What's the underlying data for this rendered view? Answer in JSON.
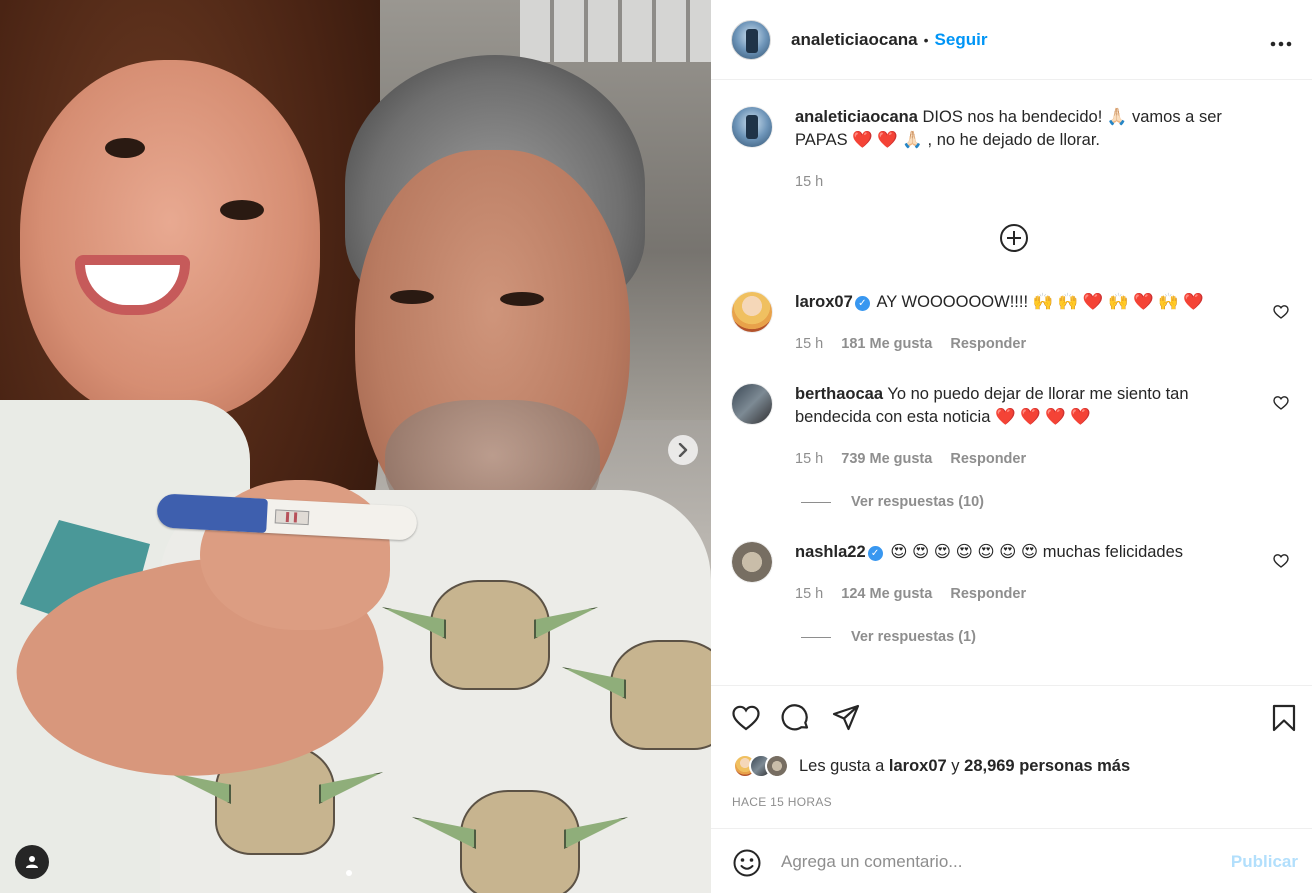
{
  "header": {
    "username": "analeticiaocana",
    "separator": "•",
    "follow_label": "Seguir",
    "more_label": "•••"
  },
  "post": {
    "caption_user": "analeticiaocana",
    "caption_text": "DIOS nos ha bendecido! 🙏🏻 vamos a ser PAPAS ❤️ ❤️ 🙏🏻 , no he dejado de llorar.",
    "time": "15 h"
  },
  "comments": [
    {
      "user": "larox07",
      "verified": true,
      "text": "AY WOOOOOOW!!!! 🙌 🙌 ❤️ 🙌 ❤️ 🙌 ❤️",
      "time": "15 h",
      "likes": "181 Me gusta",
      "reply": "Responder"
    },
    {
      "user": "berthaocaa",
      "verified": false,
      "text": "Yo no puedo dejar de llorar me siento tan bendecida con esta noticia ❤️ ❤️ ❤️ ❤️",
      "time": "15 h",
      "likes": "739 Me gusta",
      "reply": "Responder",
      "view_replies": "Ver respuestas (10)"
    },
    {
      "user": "nashla22",
      "verified": true,
      "text": "😍 😍 😍 😍 😍 😍 😍 muchas felicidades",
      "time": "15 h",
      "likes": "124 Me gusta",
      "reply": "Responder",
      "view_replies": "Ver respuestas (1)"
    }
  ],
  "likes": {
    "prefix": "Les gusta a",
    "user": "larox07",
    "connector": "y",
    "count": "28,969 personas más"
  },
  "timeago": "HACE 15 HORAS",
  "composer": {
    "placeholder": "Agrega un comentario...",
    "publish_label": "Publicar"
  },
  "colors": {
    "link_blue": "#0095f6",
    "publish_disabled": "#b2dffc",
    "secondary_text": "#8e8e8e",
    "heart_red": "#ed4956"
  },
  "icons": [
    "more-icon",
    "add-circle-icon",
    "heart-icon",
    "comment-icon",
    "share-icon",
    "bookmark-icon",
    "emoji-icon",
    "user-tag-icon",
    "chevron-right-icon",
    "verified-badge-icon"
  ]
}
